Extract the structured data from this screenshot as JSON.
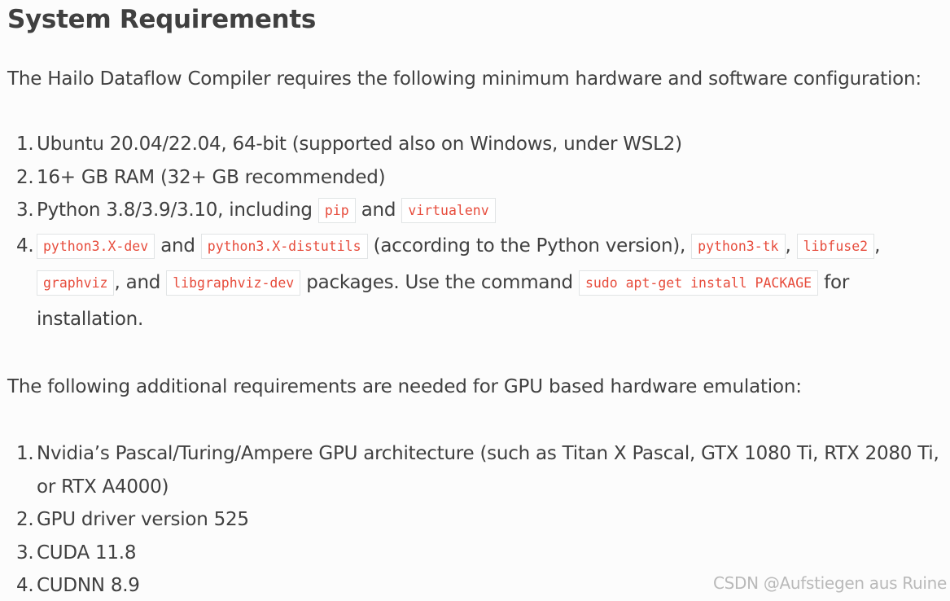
{
  "heading": "System Requirements",
  "intro1": "The Hailo Dataflow Compiler requires the following minimum hardware and software configuration:",
  "list1": {
    "item1": {
      "num": "1.",
      "text": "Ubuntu 20.04/22.04, 64-bit (supported also on Windows, under WSL2)"
    },
    "item2": {
      "num": "2.",
      "text": "16+ GB RAM (32+ GB recommended)"
    },
    "item3": {
      "num": "3.",
      "prefix": "Python 3.8/3.9/3.10, including ",
      "code1": "pip",
      "mid": " and ",
      "code2": "virtualenv"
    },
    "item4": {
      "num": "4.",
      "code1": "python3.X-dev",
      "t1": " and ",
      "code2": "python3.X-distutils",
      "t2": " (according to the Python version), ",
      "code3": "python3-tk",
      "t3": ", ",
      "code4": "libfuse2",
      "t4": ",",
      "code5": "graphviz",
      "t5": ", and ",
      "code6": "libgraphviz-dev",
      "t6": " packages. Use the command ",
      "code7": "sudo apt-get install PACKAGE",
      "t7": " for installation."
    }
  },
  "intro2": "The following additional requirements are needed for GPU based hardware emulation:",
  "list2": {
    "item1": {
      "num": "1.",
      "text": "Nvidia’s Pascal/Turing/Ampere GPU architecture (such as Titan X Pascal, GTX 1080 Ti, RTX 2080 Ti, or RTX A4000)"
    },
    "item2": {
      "num": "2.",
      "text": "GPU driver version 525"
    },
    "item3": {
      "num": "3.",
      "text": "CUDA 11.8"
    },
    "item4": {
      "num": "4.",
      "text": "CUDNN 8.9"
    }
  },
  "watermark": "CSDN @Aufstiegen aus Ruine"
}
